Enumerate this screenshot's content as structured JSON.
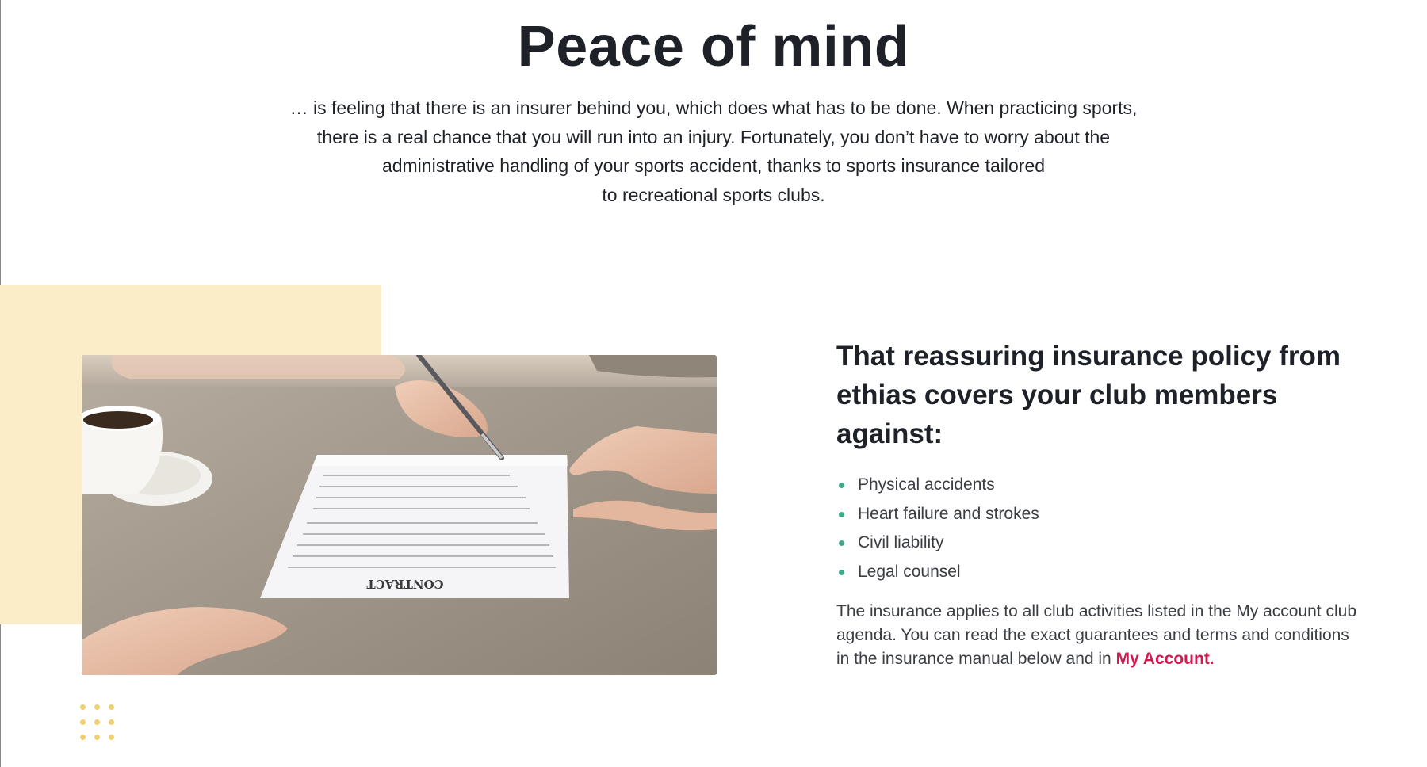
{
  "hero": {
    "title": "Peace of mind",
    "line1": "… is feeling that there is an insurer behind you, which does what has to be done. When practicing sports,",
    "line2": "there is a real chance that you will run into an injury. Fortunately, you don’t have to worry about the",
    "line3": "administrative handling of your sports accident, thanks to sports insurance tailored",
    "line4": "to recreational sports clubs."
  },
  "image": {
    "contract_text": "CONTRACT"
  },
  "coverage": {
    "heading_line1": "That reassuring insurance policy from",
    "heading_line2": "ethias covers your club members",
    "heading_line3": "against:",
    "items": [
      "Physical accidents",
      "Heart failure and strokes",
      "Civil liability",
      "Legal counsel"
    ],
    "note_text": "The insurance applies to all club activities listed in the My account club agenda. You can read the exact guarantees and terms and conditions in the insurance manual below and in",
    "link_label": "My Account."
  },
  "colors": {
    "text": "#1e2228",
    "accent_link": "#d2184f",
    "bullet": "#3ea889",
    "yellow_block": "#fbedc7",
    "dots": "#f2cf6e"
  },
  "icons": {
    "decorative_dots": "dot-grid-icon",
    "bullets": "bullet-dot-icon"
  }
}
